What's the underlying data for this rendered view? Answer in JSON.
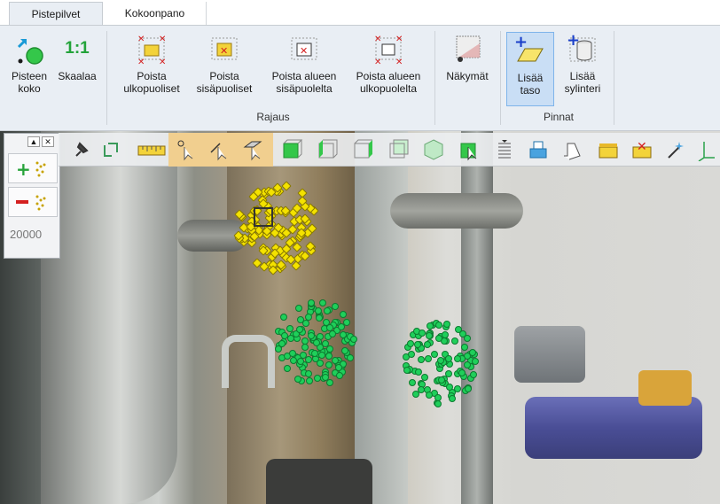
{
  "tabs": [
    {
      "label": "Pistepilvet",
      "active": true
    },
    {
      "label": "Kokoonpano",
      "active": false
    }
  ],
  "ribbon": {
    "buttons": {
      "point_size": "Pisteen koko",
      "scale": "Skaalaa",
      "scale_glyph": "1:1",
      "remove_outside": "Poista ulkopuoliset",
      "remove_inside": "Poista sisäpuoliset",
      "remove_area_inside": "Poista alueen sisäpuolelta",
      "remove_area_outside": "Poista alueen ulkopuolelta",
      "views": "Näkymät",
      "add_plane": "Lisää taso",
      "add_cylinder": "Lisää sylinteri"
    },
    "groups": {
      "clipping": "Rajaus",
      "surfaces": "Pinnat"
    }
  },
  "side_panel": {
    "value": "20000",
    "icons": [
      "add-points-icon",
      "remove-points-icon"
    ]
  },
  "view_toolbar": {
    "icons": [
      "pin-icon",
      "link-icon",
      "ruler-icon",
      "point-select-icon",
      "line-select-icon",
      "plane-select-icon",
      "cube-front-icon",
      "cube-left-icon",
      "cube-right-icon",
      "cube-back-icon",
      "cube-iso-icon",
      "cube-select-icon",
      "layers-icon",
      "cube-stack-icon",
      "profile-icon",
      "yellow-box-icon",
      "delete-box-icon",
      "magic-wand-icon",
      "axis-icon"
    ]
  },
  "colors": {
    "selection_yellow": "#f4e200",
    "selection_green": "#1fcf5a",
    "ribbon_bg": "#e9eef4",
    "highlight": "#c9def5"
  }
}
